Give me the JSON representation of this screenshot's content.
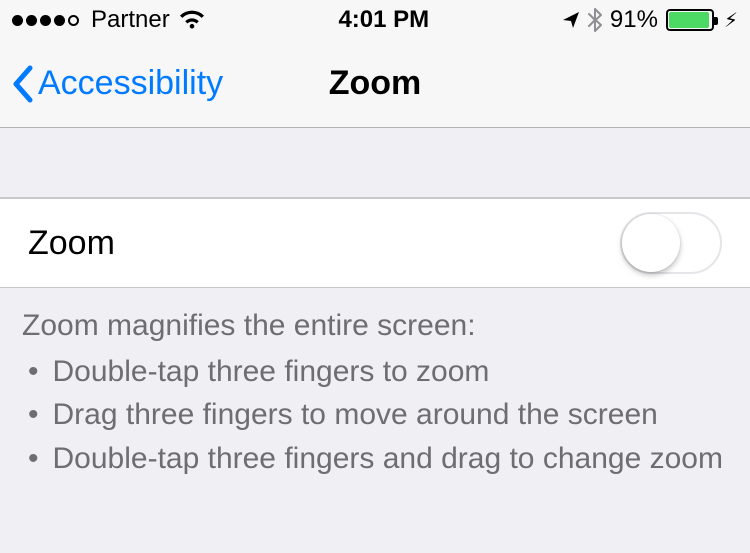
{
  "status": {
    "carrier": "Partner",
    "time": "4:01 PM",
    "battery_pct": "91%",
    "battery_fill_pct": 91
  },
  "nav": {
    "back_label": "Accessibility",
    "title": "Zoom"
  },
  "zoom_cell": {
    "label": "Zoom",
    "enabled": false
  },
  "footer": {
    "heading": "Zoom magnifies the entire screen:",
    "bullets": [
      "Double-tap three fingers to zoom",
      "Drag three fingers to move around the screen",
      "Double-tap three fingers and drag to change zoom"
    ]
  }
}
